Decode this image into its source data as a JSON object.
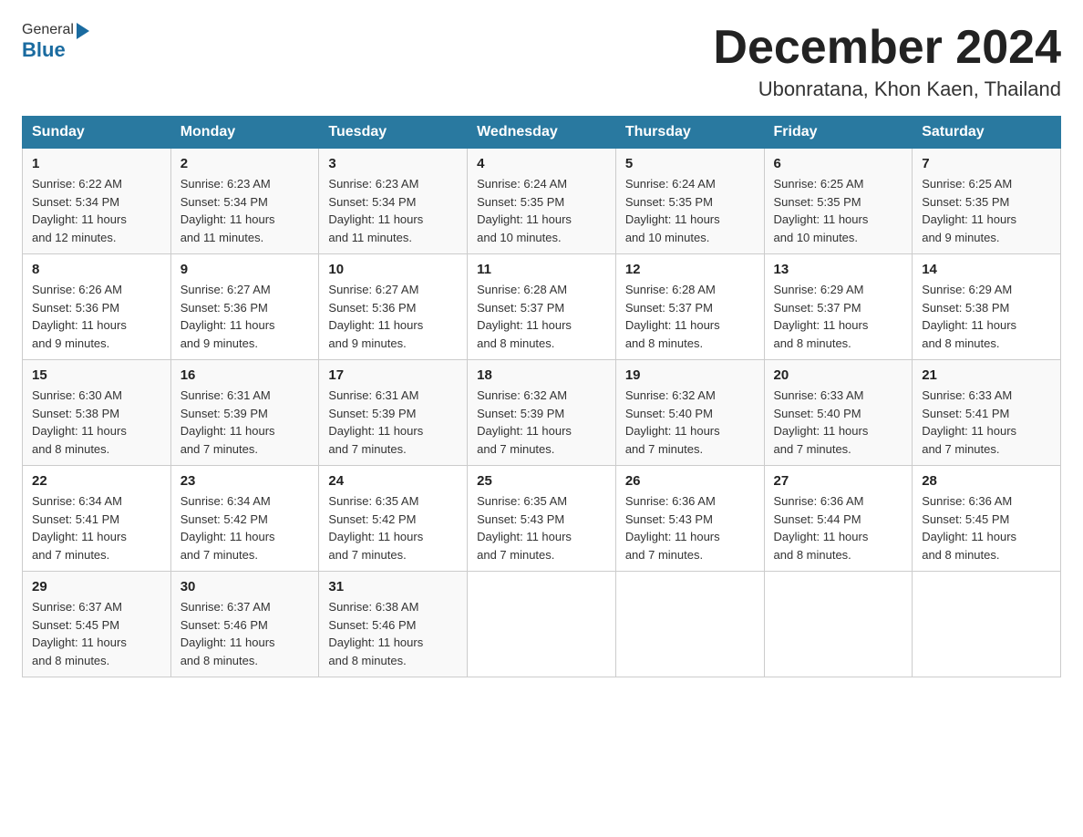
{
  "header": {
    "logo_general": "General",
    "logo_blue": "Blue",
    "month_title": "December 2024",
    "location": "Ubonratana, Khon Kaen, Thailand"
  },
  "days_of_week": [
    "Sunday",
    "Monday",
    "Tuesday",
    "Wednesday",
    "Thursday",
    "Friday",
    "Saturday"
  ],
  "weeks": [
    [
      {
        "day": "1",
        "sunrise": "6:22 AM",
        "sunset": "5:34 PM",
        "daylight": "11 hours and 12 minutes."
      },
      {
        "day": "2",
        "sunrise": "6:23 AM",
        "sunset": "5:34 PM",
        "daylight": "11 hours and 11 minutes."
      },
      {
        "day": "3",
        "sunrise": "6:23 AM",
        "sunset": "5:34 PM",
        "daylight": "11 hours and 11 minutes."
      },
      {
        "day": "4",
        "sunrise": "6:24 AM",
        "sunset": "5:35 PM",
        "daylight": "11 hours and 10 minutes."
      },
      {
        "day": "5",
        "sunrise": "6:24 AM",
        "sunset": "5:35 PM",
        "daylight": "11 hours and 10 minutes."
      },
      {
        "day": "6",
        "sunrise": "6:25 AM",
        "sunset": "5:35 PM",
        "daylight": "11 hours and 10 minutes."
      },
      {
        "day": "7",
        "sunrise": "6:25 AM",
        "sunset": "5:35 PM",
        "daylight": "11 hours and 9 minutes."
      }
    ],
    [
      {
        "day": "8",
        "sunrise": "6:26 AM",
        "sunset": "5:36 PM",
        "daylight": "11 hours and 9 minutes."
      },
      {
        "day": "9",
        "sunrise": "6:27 AM",
        "sunset": "5:36 PM",
        "daylight": "11 hours and 9 minutes."
      },
      {
        "day": "10",
        "sunrise": "6:27 AM",
        "sunset": "5:36 PM",
        "daylight": "11 hours and 9 minutes."
      },
      {
        "day": "11",
        "sunrise": "6:28 AM",
        "sunset": "5:37 PM",
        "daylight": "11 hours and 8 minutes."
      },
      {
        "day": "12",
        "sunrise": "6:28 AM",
        "sunset": "5:37 PM",
        "daylight": "11 hours and 8 minutes."
      },
      {
        "day": "13",
        "sunrise": "6:29 AM",
        "sunset": "5:37 PM",
        "daylight": "11 hours and 8 minutes."
      },
      {
        "day": "14",
        "sunrise": "6:29 AM",
        "sunset": "5:38 PM",
        "daylight": "11 hours and 8 minutes."
      }
    ],
    [
      {
        "day": "15",
        "sunrise": "6:30 AM",
        "sunset": "5:38 PM",
        "daylight": "11 hours and 8 minutes."
      },
      {
        "day": "16",
        "sunrise": "6:31 AM",
        "sunset": "5:39 PM",
        "daylight": "11 hours and 7 minutes."
      },
      {
        "day": "17",
        "sunrise": "6:31 AM",
        "sunset": "5:39 PM",
        "daylight": "11 hours and 7 minutes."
      },
      {
        "day": "18",
        "sunrise": "6:32 AM",
        "sunset": "5:39 PM",
        "daylight": "11 hours and 7 minutes."
      },
      {
        "day": "19",
        "sunrise": "6:32 AM",
        "sunset": "5:40 PM",
        "daylight": "11 hours and 7 minutes."
      },
      {
        "day": "20",
        "sunrise": "6:33 AM",
        "sunset": "5:40 PM",
        "daylight": "11 hours and 7 minutes."
      },
      {
        "day": "21",
        "sunrise": "6:33 AM",
        "sunset": "5:41 PM",
        "daylight": "11 hours and 7 minutes."
      }
    ],
    [
      {
        "day": "22",
        "sunrise": "6:34 AM",
        "sunset": "5:41 PM",
        "daylight": "11 hours and 7 minutes."
      },
      {
        "day": "23",
        "sunrise": "6:34 AM",
        "sunset": "5:42 PM",
        "daylight": "11 hours and 7 minutes."
      },
      {
        "day": "24",
        "sunrise": "6:35 AM",
        "sunset": "5:42 PM",
        "daylight": "11 hours and 7 minutes."
      },
      {
        "day": "25",
        "sunrise": "6:35 AM",
        "sunset": "5:43 PM",
        "daylight": "11 hours and 7 minutes."
      },
      {
        "day": "26",
        "sunrise": "6:36 AM",
        "sunset": "5:43 PM",
        "daylight": "11 hours and 7 minutes."
      },
      {
        "day": "27",
        "sunrise": "6:36 AM",
        "sunset": "5:44 PM",
        "daylight": "11 hours and 8 minutes."
      },
      {
        "day": "28",
        "sunrise": "6:36 AM",
        "sunset": "5:45 PM",
        "daylight": "11 hours and 8 minutes."
      }
    ],
    [
      {
        "day": "29",
        "sunrise": "6:37 AM",
        "sunset": "5:45 PM",
        "daylight": "11 hours and 8 minutes."
      },
      {
        "day": "30",
        "sunrise": "6:37 AM",
        "sunset": "5:46 PM",
        "daylight": "11 hours and 8 minutes."
      },
      {
        "day": "31",
        "sunrise": "6:38 AM",
        "sunset": "5:46 PM",
        "daylight": "11 hours and 8 minutes."
      },
      null,
      null,
      null,
      null
    ]
  ],
  "labels": {
    "sunrise": "Sunrise:",
    "sunset": "Sunset:",
    "daylight": "Daylight:"
  }
}
